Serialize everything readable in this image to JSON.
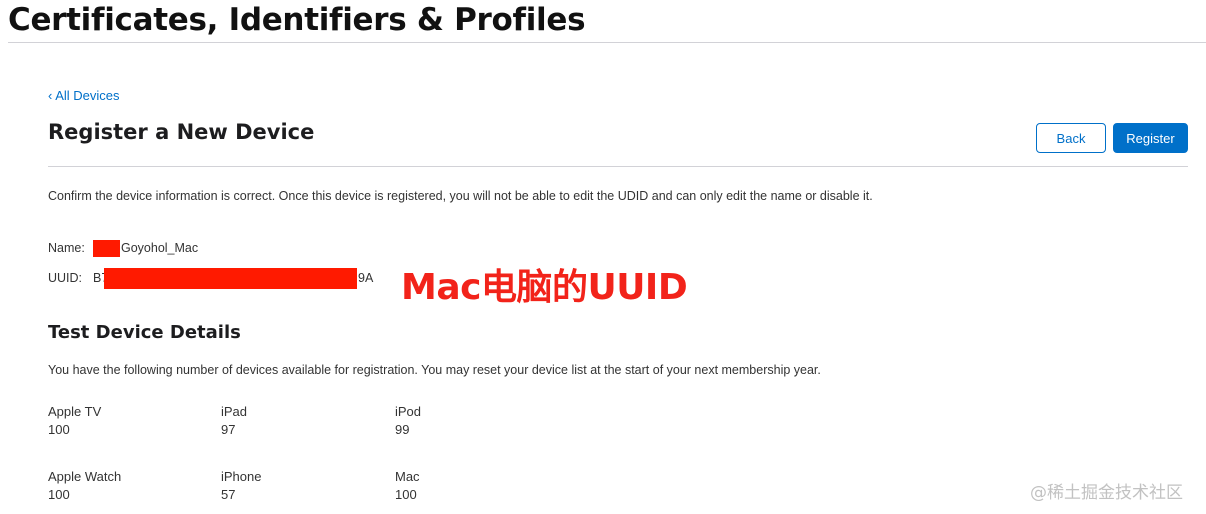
{
  "header": {
    "title": "Certificates, Identifiers & Profiles"
  },
  "nav": {
    "back_link": "‹ All Devices"
  },
  "page": {
    "title": "Register a New Device"
  },
  "actions": {
    "back_label": "Back",
    "register_label": "Register"
  },
  "confirm_text": "Confirm the device information is correct. Once this device is registered, you will not be able to edit the UDID and can only edit the name or disable it.",
  "device": {
    "name_label": "Name:",
    "name_value": "Goyohol_Mac",
    "udid_label": "UUID:",
    "udid_prefix": "B7",
    "udid_suffix": "9A",
    "redaction_color": "#ff1a00"
  },
  "annotation": {
    "text": "Mac电脑的UUID",
    "color": "#f2231a"
  },
  "test_details": {
    "title": "Test Device Details",
    "description": "You have the following number of devices available for registration. You may reset your device list at the start of your next membership year.",
    "devices": [
      {
        "name": "Apple TV",
        "count": "100"
      },
      {
        "name": "iPad",
        "count": "97"
      },
      {
        "name": "iPod",
        "count": "99"
      },
      {
        "name": "Apple Watch",
        "count": "100"
      },
      {
        "name": "iPhone",
        "count": "57"
      },
      {
        "name": "Mac",
        "count": "100"
      }
    ]
  },
  "watermark": "@稀土掘金技术社区",
  "colors": {
    "accent": "#0070c9",
    "text": "#1d1d1f",
    "divider": "#d2d2d7"
  }
}
